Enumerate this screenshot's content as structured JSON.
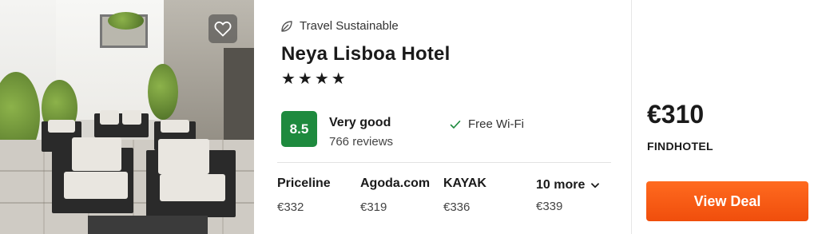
{
  "hotel": {
    "sustainability_label": "Travel Sustainable",
    "name": "Neya Lisboa Hotel",
    "stars": 4,
    "stars_text": "★★★★",
    "favorite_icon": "heart-outline-icon",
    "sustainability_icon": "leaf-icon"
  },
  "rating": {
    "score": "8.5",
    "label": "Very good",
    "reviews": "766 reviews",
    "score_color": "#1e8a3e"
  },
  "amenities": [
    {
      "label": "Free Wi-Fi",
      "icon": "check-icon"
    }
  ],
  "providers": [
    {
      "name": "Priceline",
      "price": "€332"
    },
    {
      "name": "Agoda.com",
      "price": "€319"
    },
    {
      "name": "KAYAK",
      "price": "€336"
    }
  ],
  "more": {
    "label": "10 more",
    "price": "€339",
    "icon": "chevron-down-icon"
  },
  "deal": {
    "price": "€310",
    "provider": "FINDHOTEL",
    "button_label": "View Deal",
    "button_color": "#f5570f"
  }
}
